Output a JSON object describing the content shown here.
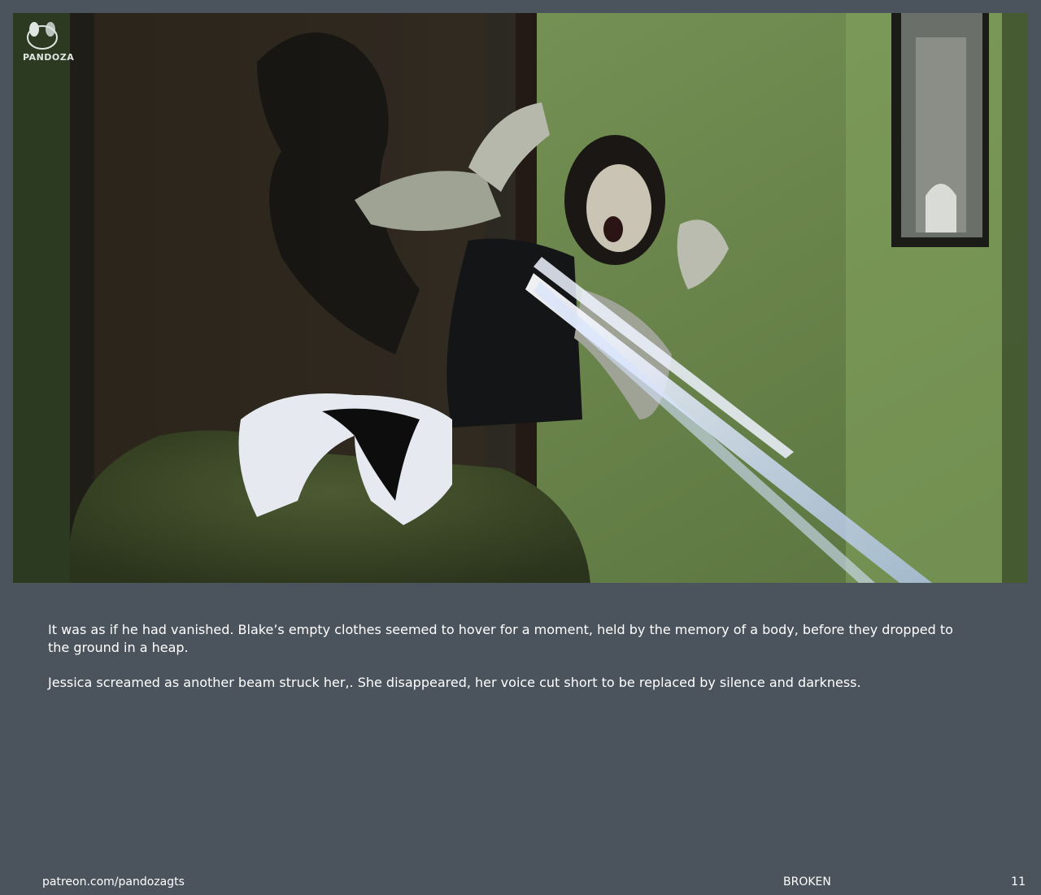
{
  "panel": {
    "logo_text": "PANDOZA",
    "logo_icon": "panda-face-icon"
  },
  "narration": {
    "paragraphs": [
      "It was as if he had vanished. Blake’s empty clothes seemed to hover for a moment, held by the memory of a body, before they dropped to the ground in a heap.",
      "Jessica screamed as another beam struck her,. She disappeared, her voice cut short to be replaced by silence and darkness."
    ]
  },
  "footer": {
    "link": "patreon.com/pandozagts",
    "title": "BROKEN",
    "page_number": "11"
  },
  "colors": {
    "page_background": "#4b545d",
    "wall": "#6e8a4f",
    "beam": "#dfe9ff"
  }
}
